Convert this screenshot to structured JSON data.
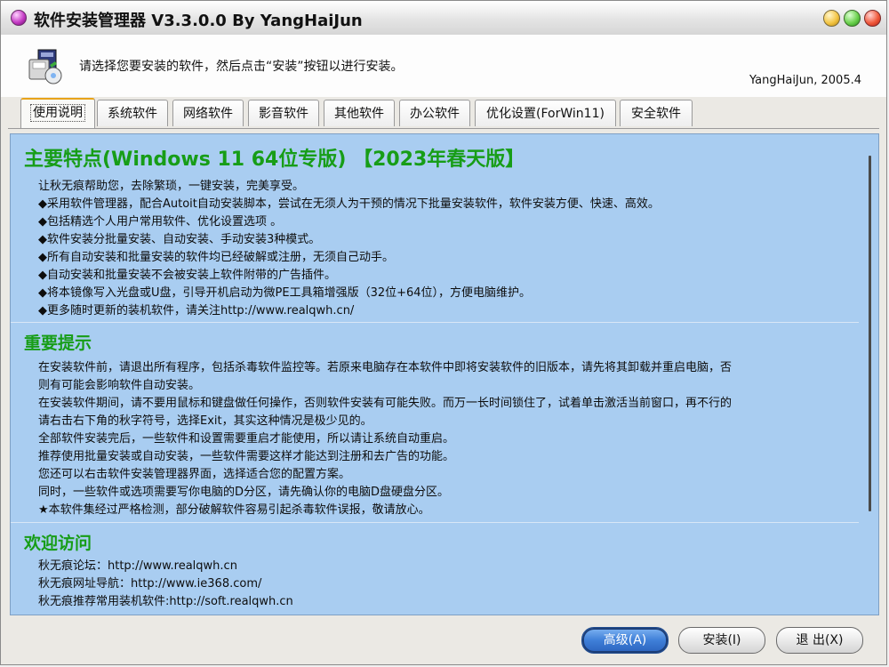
{
  "window": {
    "title": "软件安装管理器 V3.3.0.0 By YangHaiJun"
  },
  "header": {
    "instruction": "请选择您要安装的软件，然后点击“安装”按钮以进行安装。",
    "author": "YangHaiJun, 2005.4"
  },
  "tabs": [
    {
      "label": "使用说明",
      "active": true
    },
    {
      "label": "系统软件"
    },
    {
      "label": "网络软件"
    },
    {
      "label": "影音软件"
    },
    {
      "label": "其他软件"
    },
    {
      "label": "办公软件"
    },
    {
      "label": "优化设置(ForWin11)"
    },
    {
      "label": "安全软件"
    }
  ],
  "content": {
    "features": {
      "heading": "主要特点(Windows 11 64位专版) 【2023年春天版】",
      "lines": [
        "让秋无痕帮助您，去除繁琐，一键安装，完美享受。",
        "◆采用软件管理器，配合Autoit自动安装脚本，尝试在无须人为干预的情况下批量安装软件，软件安装方便、快速、高效。",
        "◆包括精选个人用户常用软件、优化设置选项 。",
        "◆软件安装分批量安装、自动安装、手动安装3种模式。",
        "◆所有自动安装和批量安装的软件均已经破解或注册，无须自己动手。",
        "◆自动安装和批量安装不会被安装上软件附带的广告插件。",
        "◆将本镜像写入光盘或U盘，引导开机启动为微PE工具箱增强版（32位+64位），方便电脑维护。",
        "◆更多随时更新的装机软件，请关注http://www.realqwh.cn/"
      ]
    },
    "tips": {
      "heading": "重要提示",
      "lines": [
        "在安装软件前，请退出所有程序，包括杀毒软件监控等。若原来电脑存在本软件中即将安装软件的旧版本，请先将其卸载并重启电脑，否",
        "则有可能会影响软件自动安装。",
        "在安装软件期间，请不要用鼠标和键盘做任何操作，否则软件安装有可能失败。而万一长时间锁住了，试着单击激活当前窗口，再不行的",
        "请右击右下角的秋字符号，选择Exit，其实这种情况是极少见的。",
        "全部软件安装完后，一些软件和设置需要重启才能使用，所以请让系统自动重启。",
        "推荐使用批量安装或自动安装，一些软件需要这样才能达到注册和去广告的功能。",
        "您还可以右击软件安装管理器界面，选择适合您的配置方案。",
        "同时，一些软件或选项需要写你电脑的D分区，请先确认你的电脑D盘硬盘分区。",
        "★本软件集经过严格检测，部分破解软件容易引起杀毒软件误报，敬请放心。"
      ]
    },
    "welcome": {
      "heading": "欢迎访问",
      "lines": [
        "秋无痕论坛：http://www.realqwh.cn",
        "秋无痕网址导航：http://www.ie368.com/",
        "秋无痕推荐常用装机软件:http://soft.realqwh.cn"
      ]
    }
  },
  "buttons": {
    "advanced": "高级(A)",
    "install": "安装(I)",
    "exit": "退 出(X)"
  },
  "colors": {
    "panel_bg": "#a9cdf1",
    "heading": "#179d17",
    "active_tab_accent": "#e8a31a",
    "default_button": "#3f7fd8"
  }
}
